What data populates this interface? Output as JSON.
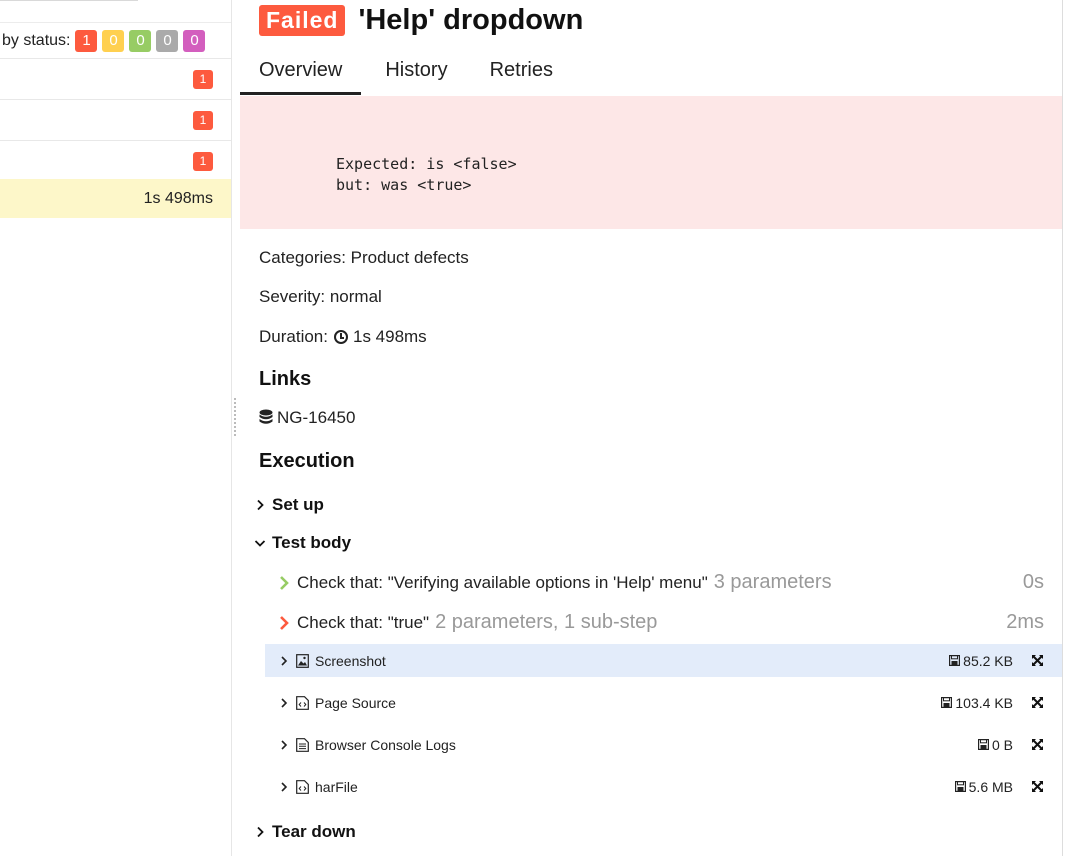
{
  "left": {
    "status_label": "by status:",
    "status_counts": [
      {
        "value": "1",
        "color": "#fd5a3e"
      },
      {
        "value": "0",
        "color": "#ffd050"
      },
      {
        "value": "0",
        "color": "#97cc64"
      },
      {
        "value": "0",
        "color": "#aaaaaa"
      },
      {
        "value": "0",
        "color": "#d35ebe"
      }
    ],
    "rows": [
      {
        "count": "1"
      },
      {
        "count": "1"
      },
      {
        "count": "1"
      }
    ],
    "selected_duration": "1s 498ms"
  },
  "test": {
    "status": "Failed",
    "title": "'Help' dropdown",
    "tabs": [
      "Overview",
      "History",
      "Retries"
    ],
    "error_line1": "Expected: is <false>",
    "error_line2": "but: was <true>",
    "categories": "Categories: Product defects",
    "severity": "Severity: normal",
    "duration_label": "Duration:",
    "duration_value": "1s 498ms",
    "links_title": "Links",
    "link": "NG-16450",
    "execution_title": "Execution",
    "stages": {
      "setup": "Set up",
      "body": "Test body",
      "teardown": "Tear down"
    },
    "steps": [
      {
        "name": "Check that: \"Verifying available options in 'Help' menu\"",
        "params": "3 parameters",
        "duration": "0s",
        "status": "passed"
      },
      {
        "name": "Check that: \"true\"",
        "params": "2 parameters, 1 sub-step",
        "duration": "2ms",
        "status": "failed"
      }
    ],
    "attachments": [
      {
        "name": "Screenshot",
        "size": "85.2 KB",
        "icon": "image-file-icon"
      },
      {
        "name": "Page Source",
        "size": "103.4 KB",
        "icon": "code-file-icon"
      },
      {
        "name": "Browser Console Logs",
        "size": "0 B",
        "icon": "text-file-icon"
      },
      {
        "name": "harFile",
        "size": "5.6 MB",
        "icon": "code-file-icon"
      }
    ]
  },
  "colors": {
    "failed": "#fd5a3e",
    "passed": "#97cc64",
    "error_bg": "#fde7e7",
    "selected_row": "#fdf7c9",
    "selected_attachment": "#e3ecfa"
  }
}
